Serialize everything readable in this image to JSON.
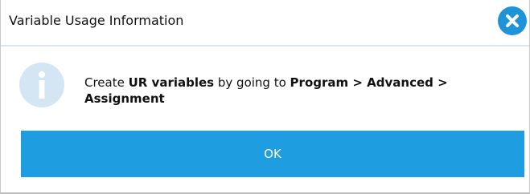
{
  "dialog": {
    "title": "Variable Usage Information",
    "close_icon": "close-icon",
    "info_icon": "info-icon",
    "message": {
      "text_1": "Create ",
      "bold_1": "UR variables",
      "text_2": " by going to ",
      "bold_2": "Program > Advanced > Assignment"
    },
    "ok_label": "OK"
  },
  "colors": {
    "accent": "#1e9ee0",
    "close_button": "#1e93da",
    "info_icon_bg": "#d4e6f3"
  }
}
